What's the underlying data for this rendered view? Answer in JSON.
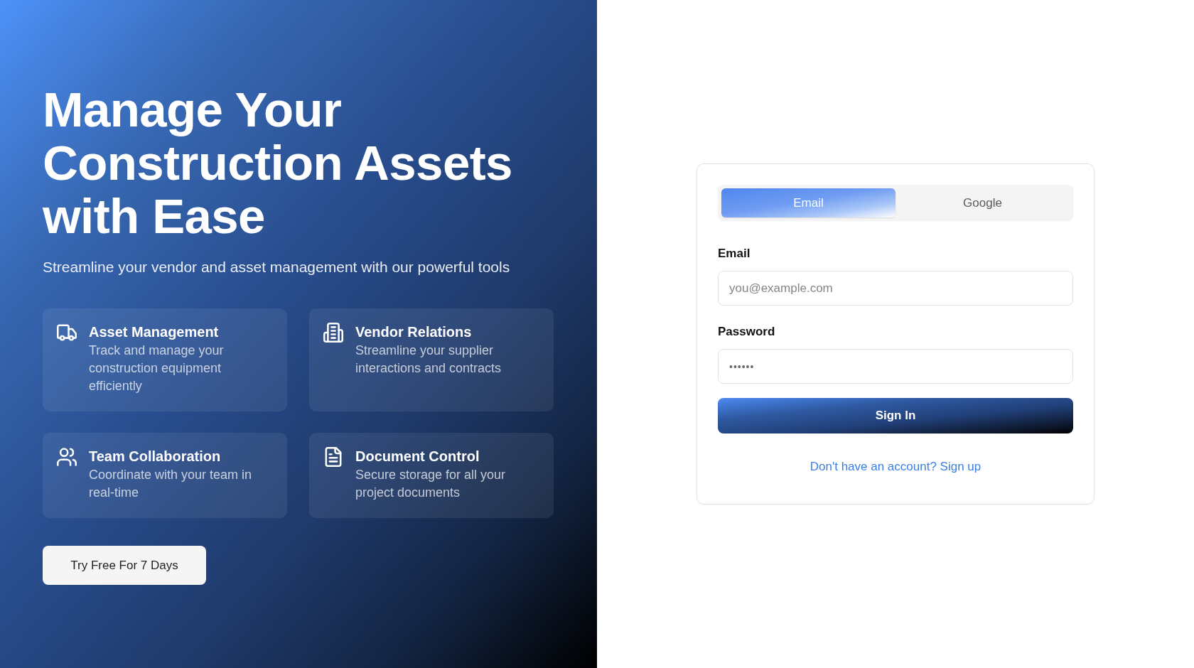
{
  "hero": {
    "title": "Manage Your Construction Assets with Ease",
    "subtitle": "Streamline your vendor and asset management with our powerful tools",
    "features": [
      {
        "title": "Asset Management",
        "description": "Track and manage your construction equipment efficiently"
      },
      {
        "title": "Vendor Relations",
        "description": "Streamline your supplier interactions and contracts"
      },
      {
        "title": "Team Collaboration",
        "description": "Coordinate with your team in real-time"
      },
      {
        "title": "Document Control",
        "description": "Secure storage for all your project documents"
      }
    ],
    "cta": "Try Free For 7 Days"
  },
  "login": {
    "tabs": [
      {
        "label": "Email",
        "selected": true
      },
      {
        "label": "Google",
        "selected": false
      }
    ],
    "fields": [
      {
        "kind": "email",
        "label": "Email",
        "placeholder": "you@example.com"
      },
      {
        "kind": "password",
        "label": "Password",
        "value": "••••••"
      }
    ],
    "submit": "Sign In",
    "signup_link": "Don't have an account? Sign up"
  }
}
